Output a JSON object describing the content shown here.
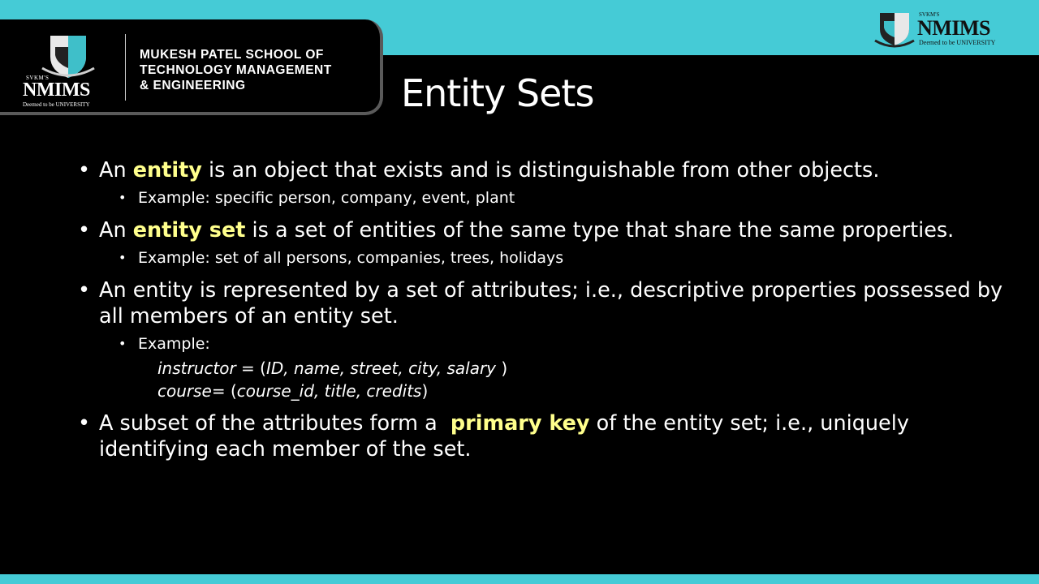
{
  "header": {
    "school_name": "MUKESH PATEL SCHOOL OF\nTECHNOLOGY MANAGEMENT\n& ENGINEERING",
    "logo_svkm": "SVKM'S",
    "logo_nmims": "NMIMS",
    "logo_deemed": "Deemed to be UNIVERSITY"
  },
  "slide": {
    "title": "Entity Sets",
    "b1": {
      "pre": "An ",
      "hl": "entity",
      "post": " is an object that exists and is distinguishable from other objects."
    },
    "b1_sub": "Example:  specific person, company, event, plant",
    "b2": {
      "pre": "An ",
      "hl": "entity set",
      "post": " is a set of entities of the same type that share the same properties."
    },
    "b2_sub": "Example: set of all persons, companies, trees, holidays",
    "b3": "An entity is represented by a set of attributes; i.e., descriptive properties possessed by all members of an entity set.",
    "b3_sub": "Example:",
    "code1": {
      "name": "instructor = ",
      "open": "(",
      "args": "ID, name, street, city, salary ",
      "close": ")"
    },
    "code2": {
      "name": "course= ",
      "open": "(",
      "args": "course_id, title, credits",
      "close": ")"
    },
    "b4": {
      "pre": "A subset of the attributes form a  ",
      "hl": "primary key",
      "post": " of the entity set; i.e., uniquely identifying each member of the set."
    }
  },
  "colors": {
    "accent_bar": "#45cbd6",
    "highlight": "#ffff8c",
    "background": "#000000"
  },
  "icons": {
    "bullet": "•",
    "logo": "nmims-shield-icon"
  }
}
